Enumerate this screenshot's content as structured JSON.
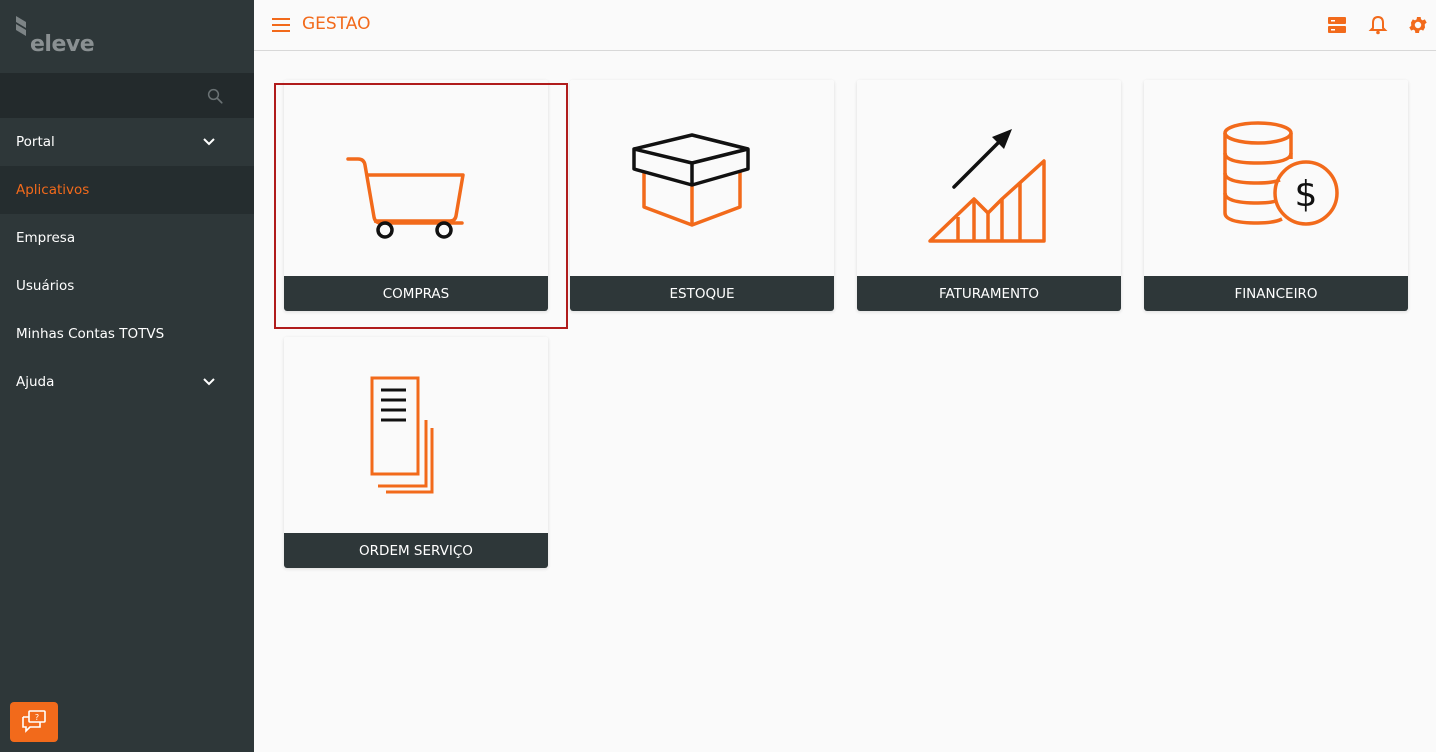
{
  "app": {
    "logo_text": "eleve",
    "header_title": "GESTAO"
  },
  "colors": {
    "accent": "#f26a1b",
    "sidebar_bg": "#2e3739",
    "card_footer_bg": "#2e3739",
    "selection_border": "#b01c1c"
  },
  "search": {
    "placeholder": ""
  },
  "sidebar": {
    "items": [
      {
        "label": "Portal",
        "has_chevron": true
      },
      {
        "label": "Aplicativos",
        "active": true
      },
      {
        "label": "Empresa"
      },
      {
        "label": "Usuários"
      },
      {
        "label": "Minhas Contas TOTVS"
      },
      {
        "label": "Ajuda",
        "has_chevron": true
      }
    ]
  },
  "header_icons": [
    "server-icon",
    "bell-icon",
    "gear-icon"
  ],
  "apps": [
    {
      "label": "COMPRAS",
      "icon": "shopping-cart-icon",
      "selected": true
    },
    {
      "label": "ESTOQUE",
      "icon": "box-icon"
    },
    {
      "label": "FATURAMENTO",
      "icon": "growth-chart-icon"
    },
    {
      "label": "FINANCEIRO",
      "icon": "coins-dollar-icon"
    },
    {
      "label": "ORDEM SERVIÇO",
      "icon": "documents-icon"
    }
  ]
}
